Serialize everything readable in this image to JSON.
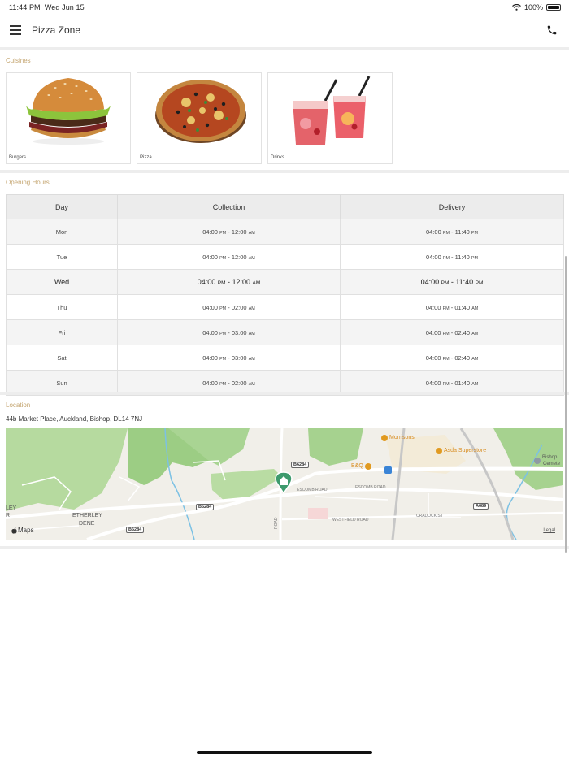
{
  "status_bar": {
    "time": "11:44 PM",
    "date": "Wed Jun 15",
    "battery": "100%",
    "battery_level": 1.0
  },
  "navbar": {
    "title": "Pizza Zone",
    "menu_icon": "hamburger-icon",
    "call_icon": "phone-icon"
  },
  "cuisines": {
    "label": "Cuisines",
    "items": [
      {
        "label": "Burgers"
      },
      {
        "label": "Pizza"
      },
      {
        "label": "Drinks"
      }
    ]
  },
  "opening_hours": {
    "label": "Opening Hours",
    "columns": [
      "Day",
      "Collection",
      "Delivery"
    ],
    "rows": [
      {
        "day": "Mon",
        "col_open": "04:00",
        "col_open_ampm": "PM",
        "col_close": "12:00",
        "col_close_ampm": "AM",
        "del_open": "04:00",
        "del_open_ampm": "PM",
        "del_close": "11:40",
        "del_close_ampm": "PM",
        "today": false
      },
      {
        "day": "Tue",
        "col_open": "04:00",
        "col_open_ampm": "PM",
        "col_close": "12:00",
        "col_close_ampm": "AM",
        "del_open": "04:00",
        "del_open_ampm": "PM",
        "del_close": "11:40",
        "del_close_ampm": "PM",
        "today": false
      },
      {
        "day": "Wed",
        "col_open": "04:00",
        "col_open_ampm": "PM",
        "col_close": "12:00",
        "col_close_ampm": "AM",
        "del_open": "04:00",
        "del_open_ampm": "PM",
        "del_close": "11:40",
        "del_close_ampm": "PM",
        "today": true
      },
      {
        "day": "Thu",
        "col_open": "04:00",
        "col_open_ampm": "PM",
        "col_close": "02:00",
        "col_close_ampm": "AM",
        "del_open": "04:00",
        "del_open_ampm": "PM",
        "del_close": "01:40",
        "del_close_ampm": "AM",
        "today": false
      },
      {
        "day": "Fri",
        "col_open": "04:00",
        "col_open_ampm": "PM",
        "col_close": "03:00",
        "col_close_ampm": "AM",
        "del_open": "04:00",
        "del_open_ampm": "PM",
        "del_close": "02:40",
        "del_close_ampm": "AM",
        "today": false
      },
      {
        "day": "Sat",
        "col_open": "04:00",
        "col_open_ampm": "PM",
        "col_close": "03:00",
        "col_close_ampm": "AM",
        "del_open": "04:00",
        "del_open_ampm": "PM",
        "del_close": "02:40",
        "del_close_ampm": "AM",
        "today": false
      },
      {
        "day": "Sun",
        "col_open": "04:00",
        "col_open_ampm": "PM",
        "col_close": "02:00",
        "col_close_ampm": "AM",
        "del_open": "04:00",
        "del_open_ampm": "PM",
        "del_close": "01:40",
        "del_close_ampm": "AM",
        "today": false
      }
    ]
  },
  "location": {
    "label": "Location",
    "address": "44b Market Place, Auckland, Bishop, DL14 7NJ",
    "map": {
      "provider": "Maps",
      "legal": "Legal",
      "pin_icon": "home-pin-icon",
      "labels": {
        "morrisons": "Morrisons",
        "asda": "Asda Superstore",
        "bq": "B&Q",
        "bishop": "Bishop",
        "cemetery": "Cemete",
        "road_b6284": "B6284",
        "road_a689": "A689",
        "escomb_road": "ESCOMB ROAD",
        "westfield_road": "WESTFIELD ROAD",
        "cradock_st": "CRADOCK ST",
        "etherley": "ETHERLEY",
        "dene": "DENE",
        "ley": "LEY",
        "r": "R",
        "road": "ROAD"
      }
    }
  },
  "colors": {
    "section_label": "#c4a570",
    "map_green": "#b3d9a3",
    "map_pin": "#3d9a6d",
    "poi_orange": "#e19a20"
  }
}
